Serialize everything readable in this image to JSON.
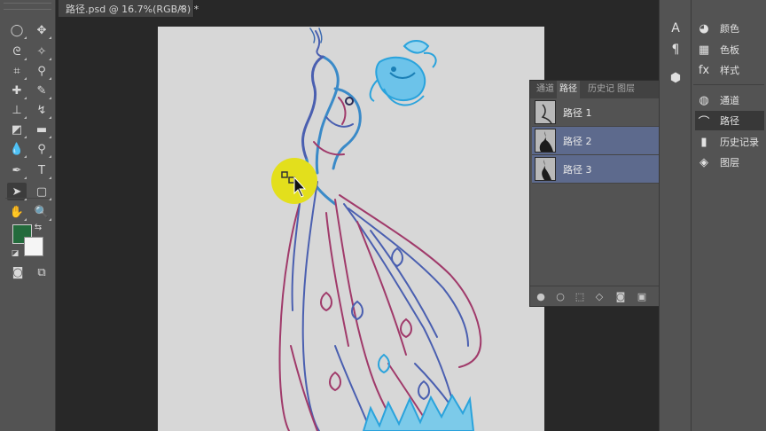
{
  "document": {
    "tab_title": "路径.psd @ 16.7%(RGB/8) *",
    "close_symbol": "×"
  },
  "toolbar": {
    "tools": [
      {
        "name": "marquee-tool-icon",
        "glyph": "◯"
      },
      {
        "name": "move-tool-icon",
        "glyph": "✥"
      },
      {
        "name": "lasso-tool-icon",
        "glyph": "ᘓ"
      },
      {
        "name": "magic-wand-tool-icon",
        "glyph": "✧"
      },
      {
        "name": "crop-tool-icon",
        "glyph": "⌗"
      },
      {
        "name": "eyedropper-tool-icon",
        "glyph": "⚲"
      },
      {
        "name": "healing-brush-tool-icon",
        "glyph": "✚"
      },
      {
        "name": "brush-tool-icon",
        "glyph": "✎"
      },
      {
        "name": "clone-stamp-tool-icon",
        "glyph": "⊥"
      },
      {
        "name": "history-brush-tool-icon",
        "glyph": "↯"
      },
      {
        "name": "eraser-tool-icon",
        "glyph": "◩"
      },
      {
        "name": "gradient-tool-icon",
        "glyph": "▬"
      },
      {
        "name": "blur-tool-icon",
        "glyph": "💧"
      },
      {
        "name": "dodge-tool-icon",
        "glyph": "⚲"
      },
      {
        "name": "pen-tool-icon",
        "glyph": "✒"
      },
      {
        "name": "type-tool-icon",
        "glyph": "T"
      },
      {
        "name": "path-selection-tool-icon",
        "glyph": "➤"
      },
      {
        "name": "shape-tool-icon",
        "glyph": "▢"
      },
      {
        "name": "hand-tool-icon",
        "glyph": "✋"
      },
      {
        "name": "zoom-tool-icon",
        "glyph": "🔍"
      }
    ],
    "foreground_color": "#236b3c",
    "background_color": "#f5f5f5"
  },
  "dock_strip": {
    "items": [
      {
        "name": "character-panel-icon",
        "glyph": "A"
      },
      {
        "name": "paragraph-panel-icon",
        "glyph": "¶"
      },
      {
        "name": "3d-panel-icon",
        "glyph": "⬢"
      }
    ]
  },
  "right_dock": {
    "items": [
      {
        "label": "颜色",
        "icon": "color-icon",
        "glyph": "◕"
      },
      {
        "label": "色板",
        "icon": "swatches-icon",
        "glyph": "▦"
      },
      {
        "label": "样式",
        "icon": "styles-icon",
        "glyph": "fx"
      },
      {
        "label": "通道",
        "icon": "channels-icon",
        "glyph": "◍"
      },
      {
        "label": "路径",
        "icon": "paths-icon",
        "glyph": "⌒"
      },
      {
        "label": "历史记录",
        "icon": "history-icon",
        "glyph": "▮"
      },
      {
        "label": "图层",
        "icon": "layers-icon",
        "glyph": "◈"
      }
    ],
    "active": "路径"
  },
  "paths_panel": {
    "tabs": [
      "通道",
      "路径",
      "历史记",
      "图层"
    ],
    "active_tab": "路径",
    "collapse_symbol": "▸▸",
    "menu_symbol": "≡",
    "paths": [
      {
        "name": "路径 1",
        "selected": false
      },
      {
        "name": "路径 2",
        "selected": true
      },
      {
        "name": "路径 3",
        "selected": true
      }
    ],
    "bottom_buttons": [
      {
        "name": "fill-path-icon",
        "glyph": "●"
      },
      {
        "name": "stroke-path-icon",
        "glyph": "○"
      },
      {
        "name": "load-as-selection-icon",
        "glyph": "⬚"
      },
      {
        "name": "make-work-path-icon",
        "glyph": "◇"
      },
      {
        "name": "add-mask-icon",
        "glyph": "◙"
      },
      {
        "name": "new-path-icon",
        "glyph": "▣"
      },
      {
        "name": "delete-path-icon",
        "glyph": "🗑"
      }
    ]
  }
}
